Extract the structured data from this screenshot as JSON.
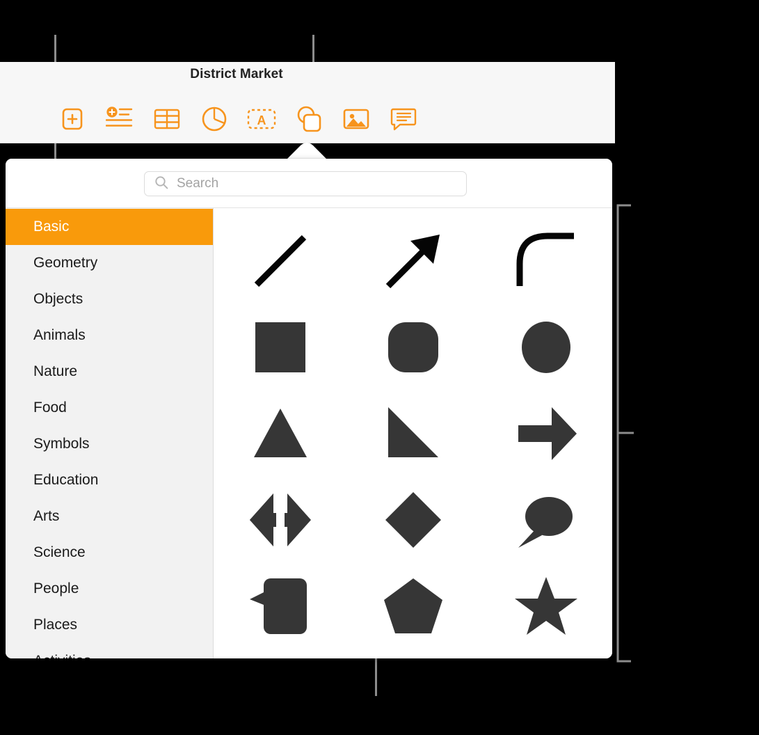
{
  "window": {
    "document_title": "District Market"
  },
  "toolbar": {
    "buttons": [
      {
        "label": "Add Page",
        "icon": "add-page-icon"
      },
      {
        "label": "Add Text",
        "icon": "add-text-icon"
      },
      {
        "label": "Table",
        "icon": "table-icon"
      },
      {
        "label": "Chart",
        "icon": "chart-icon"
      },
      {
        "label": "Text Box",
        "icon": "text-box-icon"
      },
      {
        "label": "Shape",
        "icon": "shape-icon"
      },
      {
        "label": "Media",
        "icon": "media-image-icon"
      },
      {
        "label": "Comment",
        "icon": "comment-icon"
      }
    ]
  },
  "popover": {
    "search": {
      "placeholder": "Search",
      "value": "",
      "icon": "search-icon"
    },
    "sidebar": {
      "selected": "Basic",
      "items": [
        {
          "label": "Basic"
        },
        {
          "label": "Geometry"
        },
        {
          "label": "Objects"
        },
        {
          "label": "Animals"
        },
        {
          "label": "Nature"
        },
        {
          "label": "Food"
        },
        {
          "label": "Symbols"
        },
        {
          "label": "Education"
        },
        {
          "label": "Arts"
        },
        {
          "label": "Science"
        },
        {
          "label": "People"
        },
        {
          "label": "Places"
        },
        {
          "label": "Activities"
        }
      ]
    },
    "shapes": [
      {
        "name": "line-shape"
      },
      {
        "name": "arrow-shape"
      },
      {
        "name": "curved-line-shape"
      },
      {
        "name": "square-shape"
      },
      {
        "name": "rounded-square-shape"
      },
      {
        "name": "circle-shape"
      },
      {
        "name": "triangle-shape"
      },
      {
        "name": "right-triangle-shape"
      },
      {
        "name": "right-arrow-shape"
      },
      {
        "name": "double-arrow-shape"
      },
      {
        "name": "diamond-shape"
      },
      {
        "name": "speech-bubble-oval-shape"
      },
      {
        "name": "callout-rounded-rect-shape"
      },
      {
        "name": "pentagon-shape"
      },
      {
        "name": "star-shape"
      }
    ]
  },
  "colors": {
    "accent_orange": "#f99a0b",
    "shape_fill": "#363636",
    "sidebar_bg": "#f2f2f2",
    "toolbar_bg": "#f7f7f7",
    "callout_gray": "#8c8c8c"
  }
}
